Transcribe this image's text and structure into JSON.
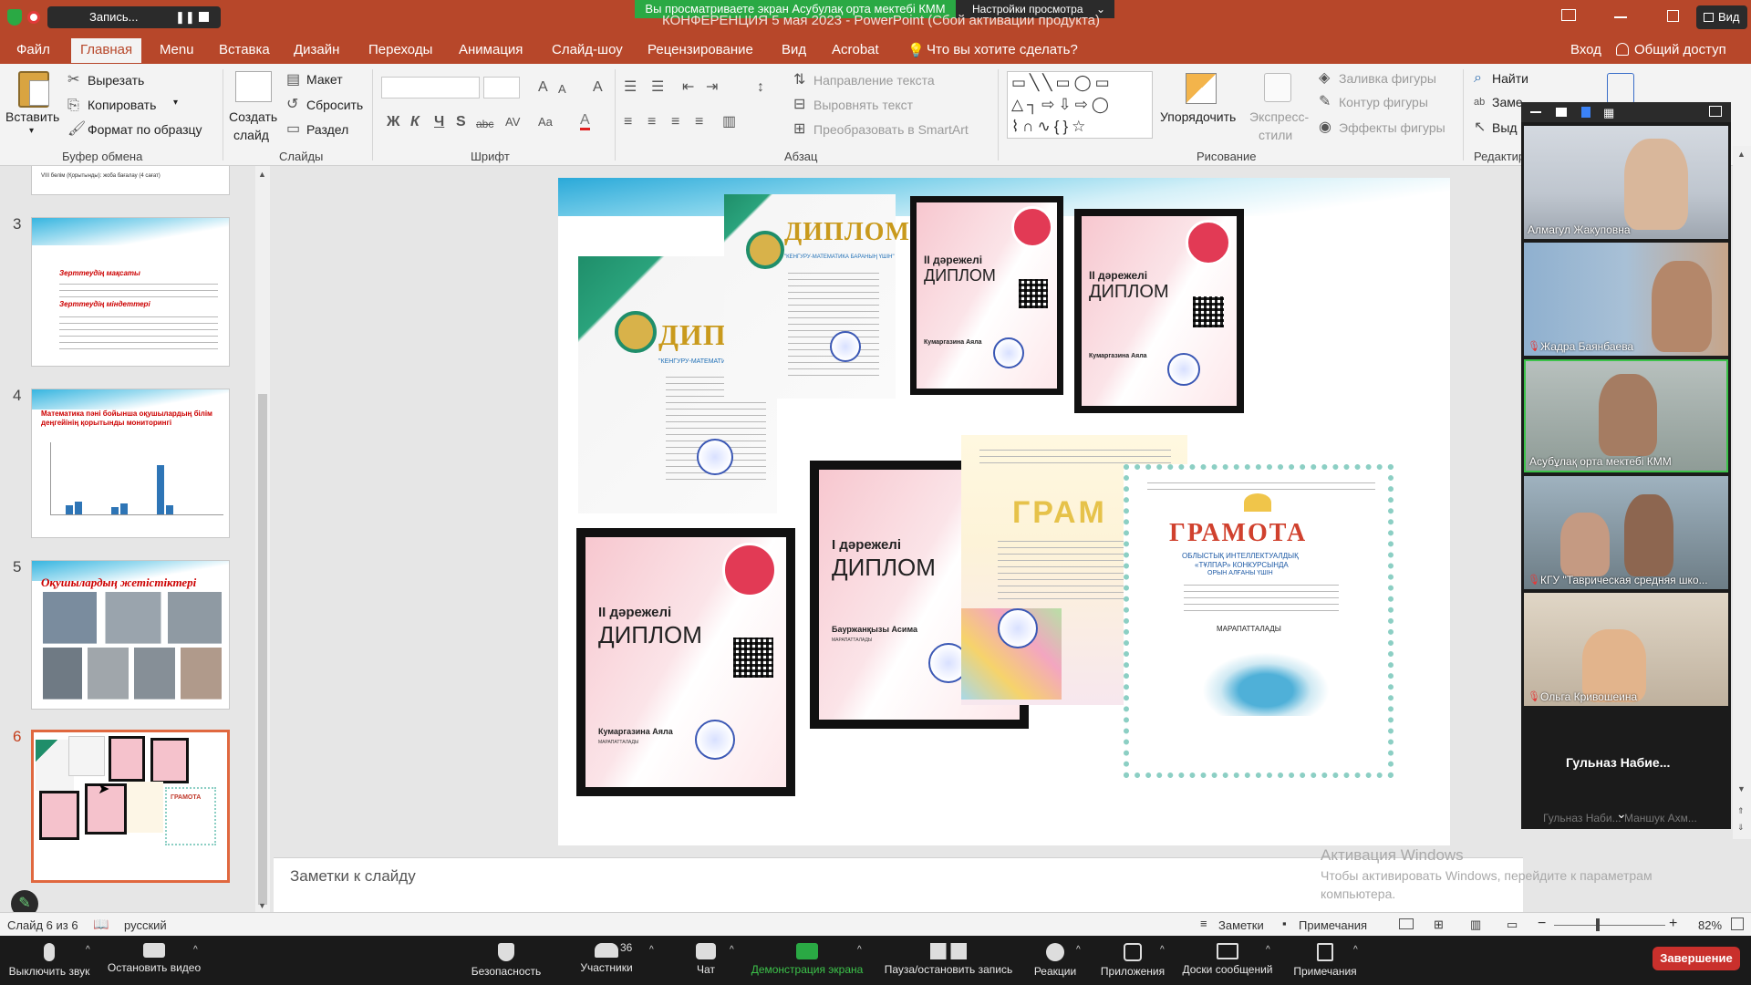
{
  "window": {
    "record_label": "Запись...",
    "screen_share_banner": "Вы просматриваете экран Асубулақ орта мектебі КММ",
    "view_settings": "Настройки просмотра",
    "doc_title": "КОНФЕРЕНЦИЯ 5 мая 2023 - PowerPoint (Сбой активации продукта)",
    "view_label": "Вид"
  },
  "menu": {
    "items": [
      "Файл",
      "Главная",
      "Menu",
      "Вставка",
      "Дизайн",
      "Переходы",
      "Анимация",
      "Слайд-шоу",
      "Рецензирование",
      "Вид",
      "Acrobat"
    ],
    "search_placeholder": "Что вы хотите сделать?",
    "signin": "Вход",
    "share": "Общий доступ"
  },
  "ribbon": {
    "paste": "Вставить",
    "cut": "Вырезать",
    "copy": "Копировать",
    "format_painter": "Формат по образцу",
    "clipboard_group": "Буфер обмена",
    "new_slide_1": "Создать",
    "new_slide_2": "слайд",
    "layout": "Макет",
    "reset": "Сбросить",
    "section": "Раздел",
    "slides_group": "Слайды",
    "font_group": "Шрифт",
    "text_direction": "Направление текста",
    "align_text": "Выровнять текст",
    "smartart": "Преобразовать в SmartArt",
    "paragraph_group": "Абзац",
    "arrange": "Упорядочить",
    "quick_styles_1": "Экспресс-",
    "quick_styles_2": "стили",
    "shape_fill": "Заливка фигуры",
    "shape_outline": "Контур фигуры",
    "shape_effects": "Эффекты фигуры",
    "drawing_group": "Рисование",
    "find": "Найти",
    "replace": "Заме",
    "select": "Выд",
    "editing_group": "Редактир"
  },
  "thumbnails": {
    "numbers": [
      "3",
      "4",
      "5",
      "6"
    ],
    "t2_text": "VIII бөлім (Қорытынды): жоба бағалау (4 сағат)",
    "t3_heading": "Зерттеудің мақсаты",
    "t3_heading2": "Зерттеудің міндеттері",
    "t4_title": "Математика пәні бойынша оқушылардың білім деңгейінің қорытынды мониторингі",
    "t5_title": "Оқушылардың жетістіктері",
    "t6_gramota": "ГРАМОТА"
  },
  "slide": {
    "diploma_word": "ДИПЛОМ",
    "kangaroo_1": "\"КЕНГУРУ-МАТЕМАТИКА БАРАНЫҢ ҮШІН\"",
    "kangaroo_2": "\"КЕНГУРУ-МАТЕМАТИКА БАРАНЫҢ ҮШІН\"",
    "place_2": "II дәрежелі",
    "place_1": "I дәрежелі",
    "dip_name_a": "Кумаргазина Аяла",
    "dip_name_b": "Кумаргазина Аяла",
    "dip_name_c": "Кумаргазина Аяла",
    "dip_name_d": "Бауржанқызы Асима",
    "awarded": "МАРАПАТТАЛАДЫ",
    "gram_partial": "ГРАМ",
    "gramota": "ГРАМОТА",
    "gramota_sub1": "ОБЛЫСТЫҚ ИНТЕЛЛЕКТУАЛДЫҚ",
    "gramota_sub2": "«ТҰЛПАР» КОНКУРСЫНДА",
    "gramota_sub3": "ОРЫН АЛҒАНЫ ҮШІН",
    "gramota_award": "МАРАПАТТАЛАДЫ"
  },
  "notes_placeholder": "Заметки к слайду",
  "activation": {
    "line1": "Активация Windows",
    "line2": "Чтобы активировать Windows, перейдите к параметрам",
    "line3": "компьютера."
  },
  "status": {
    "slide_counter": "Слайд 6 из 6",
    "language": "русский",
    "notes": "Заметки",
    "comments": "Примечания",
    "zoom": "82%"
  },
  "participants_video": [
    {
      "name": "Алмагул Жакуповна",
      "bg": "#c9cfd8"
    },
    {
      "name": "Жадра Баянбаева",
      "bg": "#a9b8c9"
    },
    {
      "name": "Асубұлақ орта мектебі КММ",
      "bg": "#9da9a4"
    },
    {
      "name": "КГУ \"Таврическая средняя шко...",
      "bg": "#7d8c94"
    },
    {
      "name": "Ольга Кривошеина",
      "bg": "#cfc6b8"
    }
  ],
  "video_text_only": "Гульназ  Набие...",
  "video_bottom_partial": "Гульназ Наби...   Маншук Ахм...",
  "zoom_toolbar": {
    "mute": "Выключить звук",
    "stop_video": "Остановить видео",
    "security": "Безопасность",
    "participants": "Участники",
    "participants_count": "36",
    "chat": "Чат",
    "share_screen": "Демонстрация экрана",
    "pause_record": "Пауза/остановить запись",
    "reactions": "Реакции",
    "apps": "Приложения",
    "whiteboards": "Доски сообщений",
    "notes": "Примечания",
    "end": "Завершение"
  },
  "colors": {
    "ppt_red": "#b7472a",
    "zoom_green": "#2aa944",
    "end_red": "#c9302c"
  }
}
